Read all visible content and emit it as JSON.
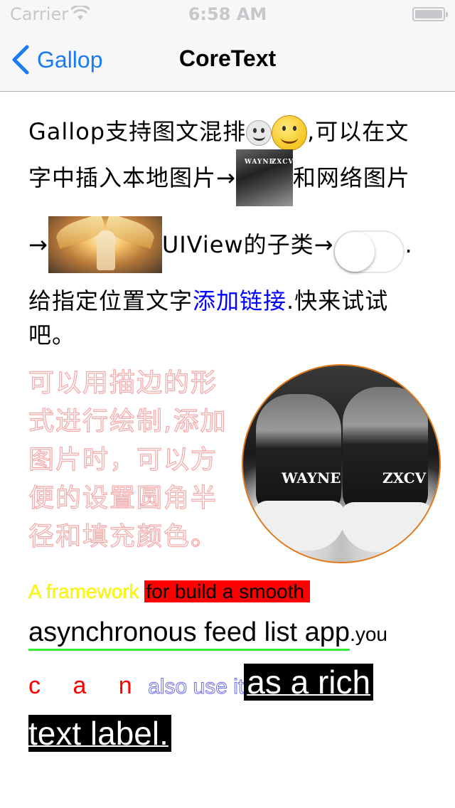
{
  "status_bar": {
    "carrier": "Carrier",
    "time": "6:58 AM"
  },
  "nav": {
    "back_label": "Gallop",
    "title": "CoreText"
  },
  "paragraph": {
    "line1_text": "Gallop支持图文混排",
    "line1_after": ",可以在文",
    "line2_before": "字中插入本地图片→",
    "line2_after": "和网络图片",
    "line3_before": "→",
    "line3_after": "UIView的子类→",
    "line3_end": ".",
    "line4_before": "给指定位置文字",
    "link_text": "添加链接",
    "line4_after": ".快来试试",
    "line5": "吧。",
    "thumb_brand_left": "WAYNE",
    "thumb_brand_right": "ZXCV"
  },
  "outlined_text": "可以用描边的形式进行绘制,添加图片时，可以方便的设置圆角半径和填充颜色。",
  "circle_image": {
    "brand_left": "WAYNE",
    "brand_right": "ZXCV"
  },
  "rich_text": {
    "yellow": "A framework ",
    "red_bg": "for build a smooth",
    "underlined": "asynchronous feed list app",
    "you": ".you",
    "can": "c a n",
    "also_use": "also use it",
    "black1": "as a rich ",
    "black2": "text label",
    "period": "."
  },
  "toggle": {
    "state": "off"
  },
  "colors": {
    "link": "#0000ff",
    "nav_accent": "#1a7cf5",
    "outline": "#f4a7a7",
    "underline": "#33ee33"
  }
}
